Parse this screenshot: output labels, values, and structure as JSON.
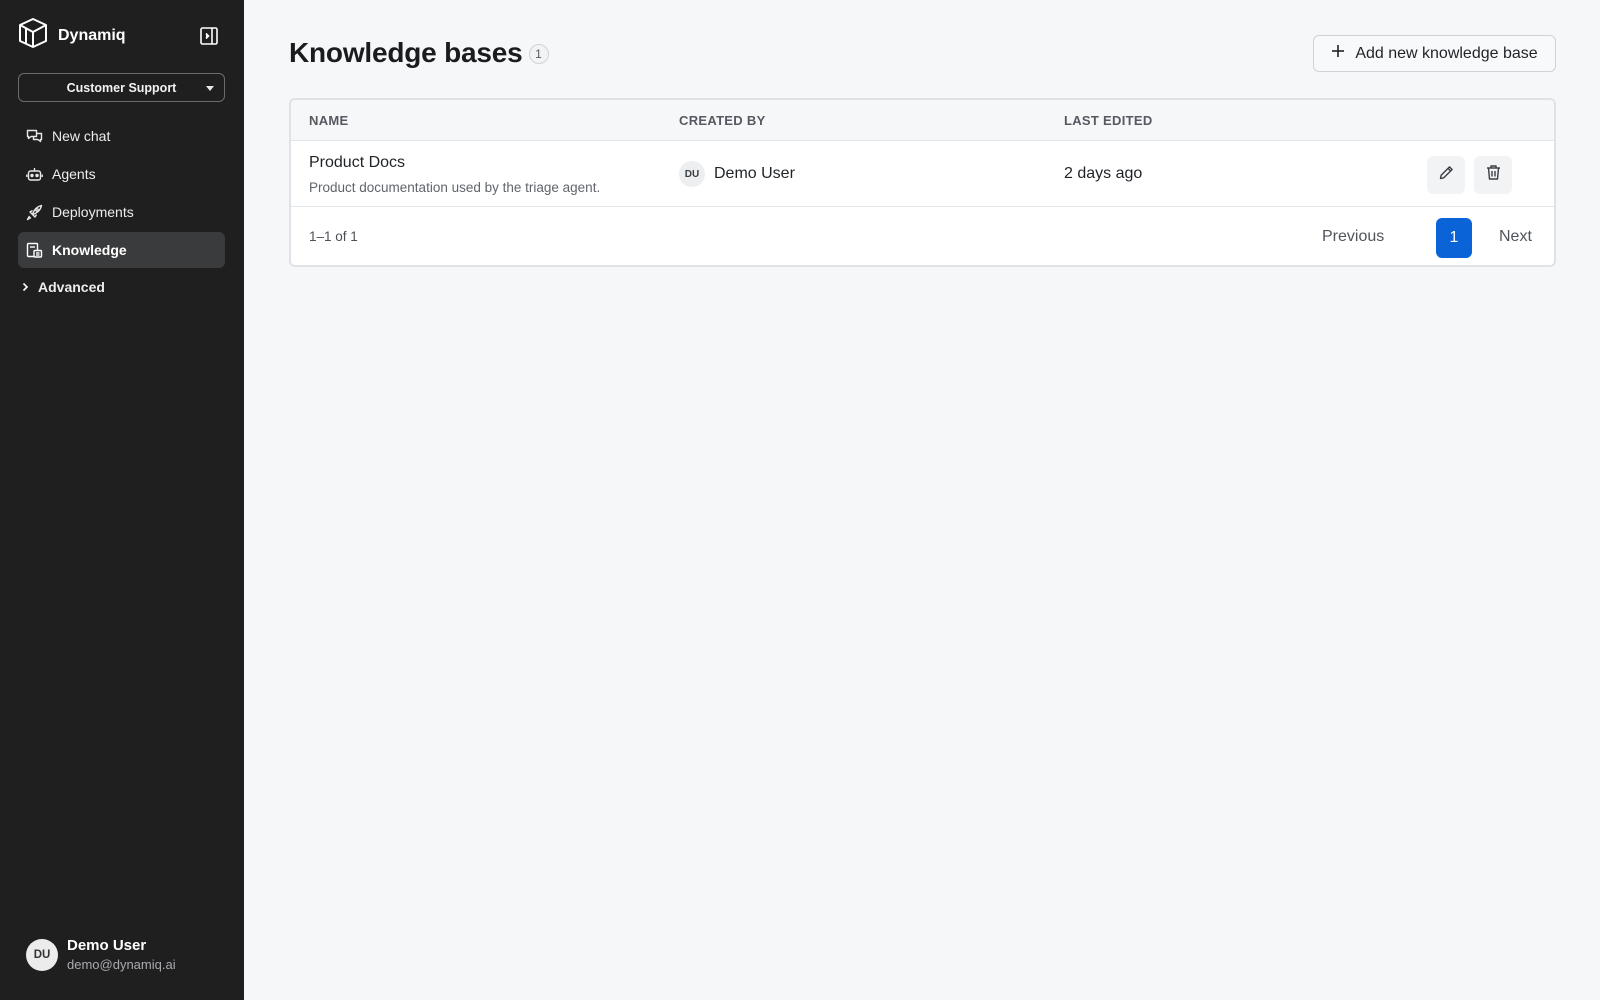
{
  "app": {
    "brand_name": "Dynamiq"
  },
  "sidebar": {
    "workspace": "Customer Support",
    "items": [
      {
        "label": "New chat",
        "icon": "chat-icon",
        "active": false
      },
      {
        "label": "Agents",
        "icon": "robot-icon",
        "active": false
      },
      {
        "label": "Deployments",
        "icon": "rocket-icon",
        "active": false
      },
      {
        "label": "Knowledge",
        "icon": "knowledge-icon",
        "active": true
      }
    ],
    "advanced_label": "Advanced",
    "user": {
      "initials": "DU",
      "name": "Demo User",
      "email": "demo@dynamiq.ai"
    }
  },
  "main": {
    "title": "Knowledge bases",
    "count": "1",
    "add_button_label": "Add new knowledge base",
    "table": {
      "columns": [
        "NAME",
        "CREATED BY",
        "LAST EDITED"
      ],
      "rows": [
        {
          "name": "Product Docs",
          "description": "Product documentation used by the triage agent.",
          "creator_initials": "DU",
          "creator_name": "Demo User",
          "last_edited": "2 days ago"
        }
      ]
    },
    "pagination": {
      "range": "1–1 of 1",
      "previous_label": "Previous",
      "current_page": "1",
      "next_label": "Next"
    }
  },
  "colors": {
    "sidebar_bg": "#1f1f20",
    "page_bg": "#f6f7f9",
    "accent": "#0a64d8"
  }
}
